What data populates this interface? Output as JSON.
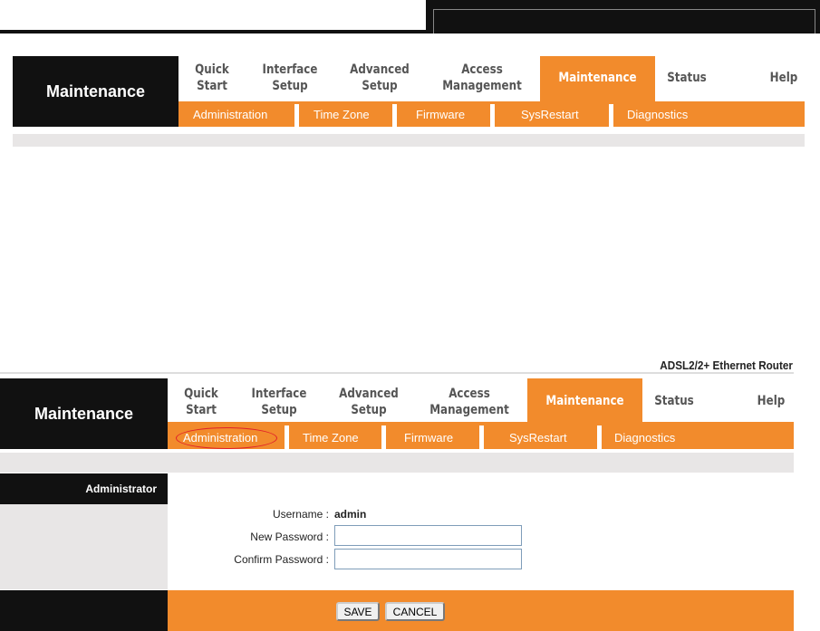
{
  "brand": "ADSL2/2+ Ethernet Router",
  "section_title": "Maintenance",
  "nav": [
    {
      "label1": "Quick",
      "label2": "Start"
    },
    {
      "label1": "Interface",
      "label2": "Setup"
    },
    {
      "label1": "Advanced",
      "label2": "Setup"
    },
    {
      "label1": "Access",
      "label2": "Management"
    },
    {
      "label1": "Maintenance",
      "label2": ""
    },
    {
      "label1": "Status",
      "label2": ""
    },
    {
      "label1": "Help",
      "label2": ""
    }
  ],
  "subnav": [
    "Administration",
    "Time Zone",
    "Firmware",
    "SysRestart",
    "Diagnostics"
  ],
  "form": {
    "section": "Administrator",
    "username_label": "Username :",
    "username_value": "admin",
    "new_password_label": "New Password :",
    "confirm_password_label": "Confirm Password :",
    "new_password_value": "",
    "confirm_password_value": "",
    "save": "SAVE",
    "cancel": "CANCEL"
  },
  "colors": {
    "accent": "#f28b2c",
    "dark": "#111111",
    "grey": "#e8e6e6"
  }
}
